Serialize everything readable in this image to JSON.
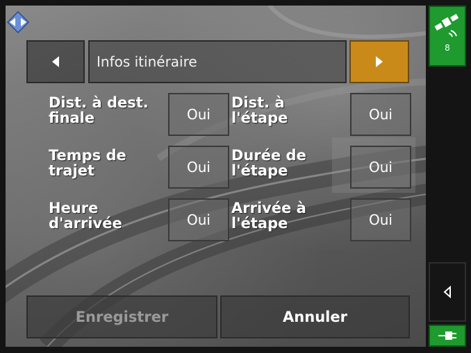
{
  "header": {
    "title": "Infos itinéraire"
  },
  "options": [
    {
      "label_line1": "Dist. à dest.",
      "label_line2": "finale",
      "value": "Oui"
    },
    {
      "label_line1": "Dist. à",
      "label_line2": "l'étape",
      "value": "Oui"
    },
    {
      "label_line1": "Temps de",
      "label_line2": "trajet",
      "value": "Oui"
    },
    {
      "label_line1": "Durée de",
      "label_line2": "l'étape",
      "value": "Oui"
    },
    {
      "label_line1": "Heure",
      "label_line2": "d'arrivée",
      "value": "Oui"
    },
    {
      "label_line1": "Arrivée à",
      "label_line2": "l'étape",
      "value": "Oui"
    }
  ],
  "buttons": {
    "save": "Enregistrer",
    "cancel": "Annuler"
  },
  "status": {
    "satellites": "8"
  },
  "colors": {
    "accent": "#c98a1a",
    "status_green": "#1f9a2e"
  },
  "icons": {
    "app": "diamond-nav-icon",
    "prev": "arrow-left-icon",
    "next": "arrow-right-icon",
    "gps": "satellite-icon",
    "back": "chevron-left-icon",
    "power": "power-plug-icon"
  }
}
